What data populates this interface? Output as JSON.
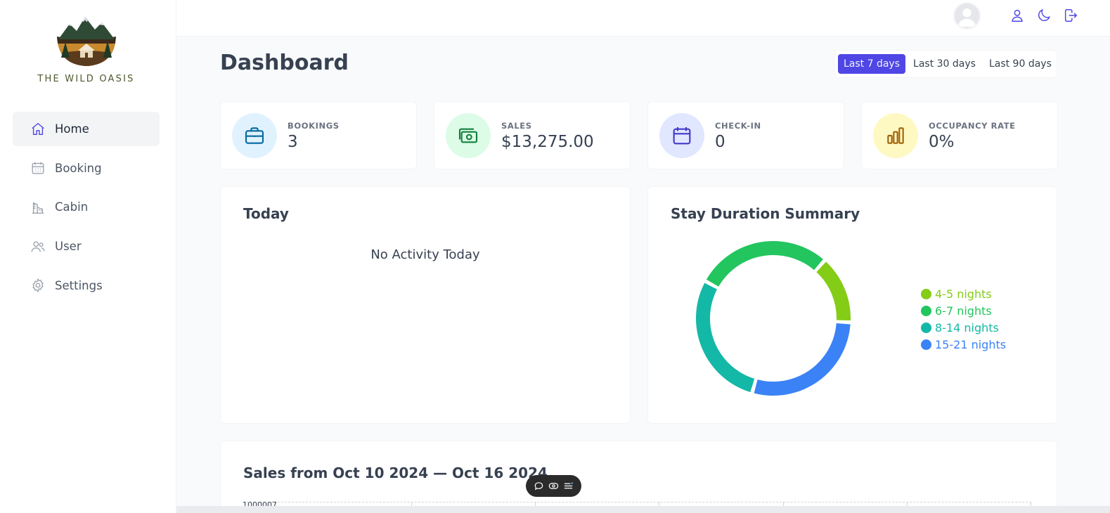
{
  "brand": {
    "name": "THE WILD OASIS"
  },
  "sidebar": {
    "items": [
      {
        "label": "Home",
        "icon": "home-icon",
        "active": true
      },
      {
        "label": "Booking",
        "icon": "calendar-icon",
        "active": false
      },
      {
        "label": "Cabin",
        "icon": "building-icon",
        "active": false
      },
      {
        "label": "User",
        "icon": "users-icon",
        "active": false
      },
      {
        "label": "Settings",
        "icon": "gear-icon",
        "active": false
      }
    ]
  },
  "header": {
    "icons": [
      "user-icon",
      "moon-icon",
      "logout-icon"
    ]
  },
  "main": {
    "title": "Dashboard",
    "filters": [
      {
        "label": "Last 7 days",
        "active": true
      },
      {
        "label": "Last 30 days",
        "active": false
      },
      {
        "label": "Last 90 days",
        "active": false
      }
    ],
    "stats": [
      {
        "title": "BOOKINGS",
        "value": "3",
        "icon": "briefcase-icon",
        "bg": "#e0f2fe",
        "color": "#0369a1"
      },
      {
        "title": "SALES",
        "value": "$13,275.00",
        "icon": "banknotes-icon",
        "bg": "#dcfce7",
        "color": "#15803d"
      },
      {
        "title": "CHECK-IN",
        "value": "0",
        "icon": "calendar-icon",
        "bg": "#e0e7ff",
        "color": "#4338ca"
      },
      {
        "title": "OCCUPANCY RATE",
        "value": "0%",
        "icon": "chart-bar-icon",
        "bg": "#fef9c3",
        "color": "#a16207"
      }
    ],
    "today": {
      "title": "Today",
      "empty_text": "No Activity Today"
    },
    "duration": {
      "title": "Stay Duration Summary"
    },
    "sales": {
      "title": "Sales from Oct 10 2024 — Oct 16 2024",
      "y_label_partial": "1000007"
    }
  },
  "chart_data": {
    "type": "pie",
    "title": "Stay Duration Summary",
    "categories": [
      "4-5 nights",
      "6-7 nights",
      "8-14 nights",
      "15-21 nights"
    ],
    "values": [
      1,
      2,
      2,
      2
    ],
    "colors": [
      "#84cc16",
      "#22c55e",
      "#14b8a6",
      "#3b82f6"
    ],
    "donut": true,
    "legend_position": "right"
  }
}
